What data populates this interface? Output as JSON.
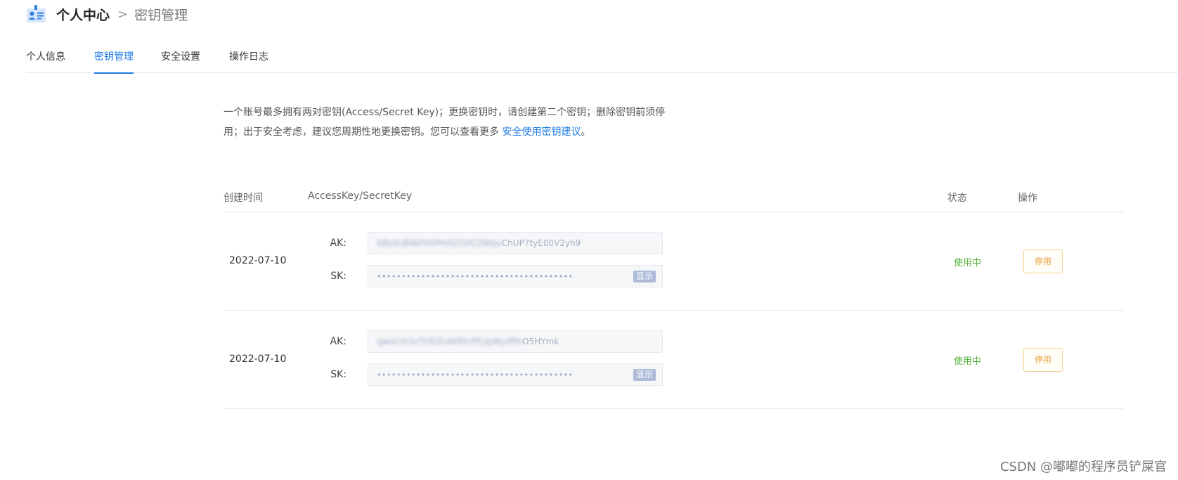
{
  "header": {
    "title": "个人中心",
    "separator": ">",
    "current": "密钥管理"
  },
  "tabs": [
    {
      "label": "个人信息",
      "active": false
    },
    {
      "label": "密钥管理",
      "active": true
    },
    {
      "label": "安全设置",
      "active": false
    },
    {
      "label": "操作日志",
      "active": false
    }
  ],
  "notice": {
    "line1": "一个账号最多拥有两对密钥(Access/Secret Key)；更换密钥时，请创建第二个密钥；删除密钥前须停",
    "line2_prefix": "用；出于安全考虑，建议您周期性地更换密钥。您可以查看更多 ",
    "link": "安全使用密钥建议",
    "line2_suffix": "。"
  },
  "table": {
    "headers": {
      "created": "创建时间",
      "keys": "AccessKey/SecretKey",
      "status": "状态",
      "action": "操作"
    },
    "rows": [
      {
        "date": "2022-07-10",
        "ak_label": "AK:",
        "ak_masked": "bBo5cB4kFHXPmQ7zAC2Wpu",
        "ak_visible": "ChUP7tyE00V2yh9",
        "sk_label": "SK:",
        "sk_value": "••••••••••••••••••••••••••••••••••••••••",
        "show_label": "显示",
        "status": "使用中",
        "action": "停用"
      },
      {
        "date": "2022-07-10",
        "ak_label": "AK:",
        "ak_masked": "qwxCm3xTt3tZLAkfHcPfLtpWyzPfs",
        "ak_visible": "O5HYmk",
        "sk_label": "SK:",
        "sk_value": "••••••••••••••••••••••••••••••••••••••••",
        "show_label": "显示",
        "status": "使用中",
        "action": "停用"
      }
    ]
  },
  "watermark": "CSDN @嘟嘟的程序员铲屎官",
  "colors": {
    "accent": "#1f7be6",
    "status_active": "#56b13c",
    "warning": "#e6a23c"
  }
}
